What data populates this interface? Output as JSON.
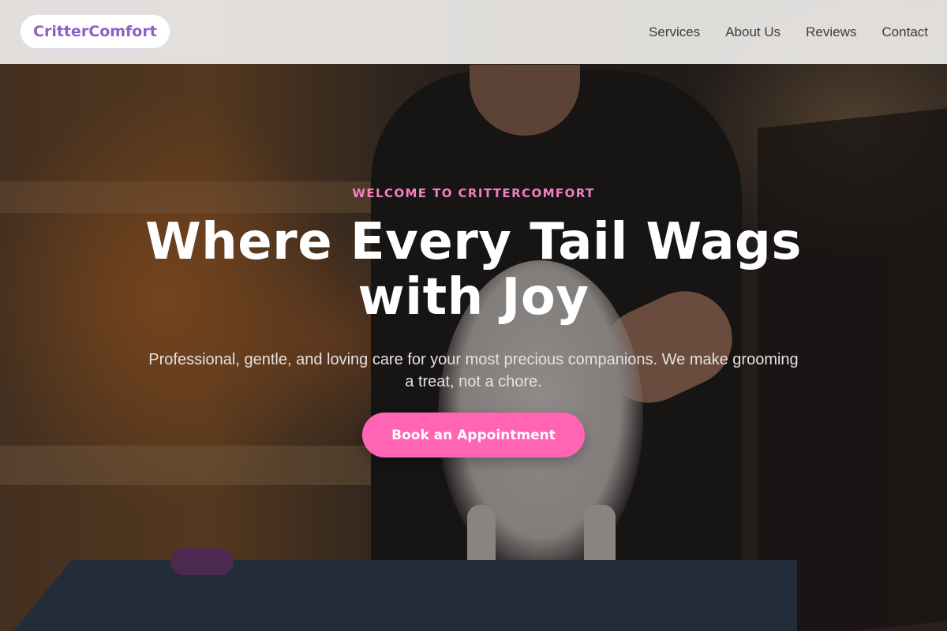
{
  "brand": {
    "name": "CritterComfort"
  },
  "nav": {
    "items": [
      {
        "label": "Services"
      },
      {
        "label": "About Us"
      },
      {
        "label": "Reviews"
      },
      {
        "label": "Contact"
      }
    ]
  },
  "hero": {
    "eyebrow": "WELCOME TO CRITTERCOMFORT",
    "headline": "Where Every Tail Wags with Joy",
    "subtitle": "Professional, gentle, and loving care for your most precious companions. We make grooming a treat, not a chore.",
    "cta_label": "Book an Appointment"
  },
  "colors": {
    "brand_purple": "#8b62c6",
    "accent_pink": "#ff64b5",
    "eyebrow_pink": "#f27fc0"
  }
}
